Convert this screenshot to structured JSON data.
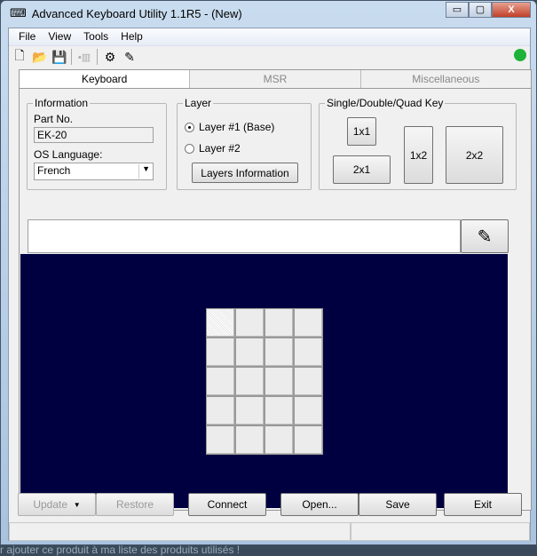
{
  "window": {
    "title": "Advanced Keyboard Utility 1.1R5  - (New)",
    "minimize": "▭",
    "maximize": "▢",
    "close": "X"
  },
  "menu": [
    "File",
    "View",
    "Tools",
    "Help"
  ],
  "tabs": [
    {
      "label": "Keyboard",
      "active": true
    },
    {
      "label": "MSR"
    },
    {
      "label": "Miscellaneous"
    }
  ],
  "information": {
    "legend": "Information",
    "part_label": "Part No.",
    "part_value": "EK-20",
    "os_label": "OS Language:",
    "os_value": "French"
  },
  "layer": {
    "legend": "Layer",
    "layer1": "Layer #1 (Base)",
    "layer2": "Layer #2",
    "selected": "layer1",
    "info_button": "Layers Information"
  },
  "keysize": {
    "legend": "Single/Double/Quad Key",
    "b1x1": "1x1",
    "b2x1": "2x1",
    "b1x2": "1x2",
    "b2x2": "2x2"
  },
  "key_text": "",
  "key_grid": {
    "cols": 4,
    "rows": 5,
    "selected": [
      0,
      0
    ]
  },
  "buttons": {
    "update": "Update",
    "restore": "Restore",
    "connect": "Connect",
    "open": "Open...",
    "save": "Save",
    "exit": "Exit"
  },
  "connection_color": "#1fb23a",
  "background_text": "r ajouter ce produit à ma liste des produits utilisés !"
}
